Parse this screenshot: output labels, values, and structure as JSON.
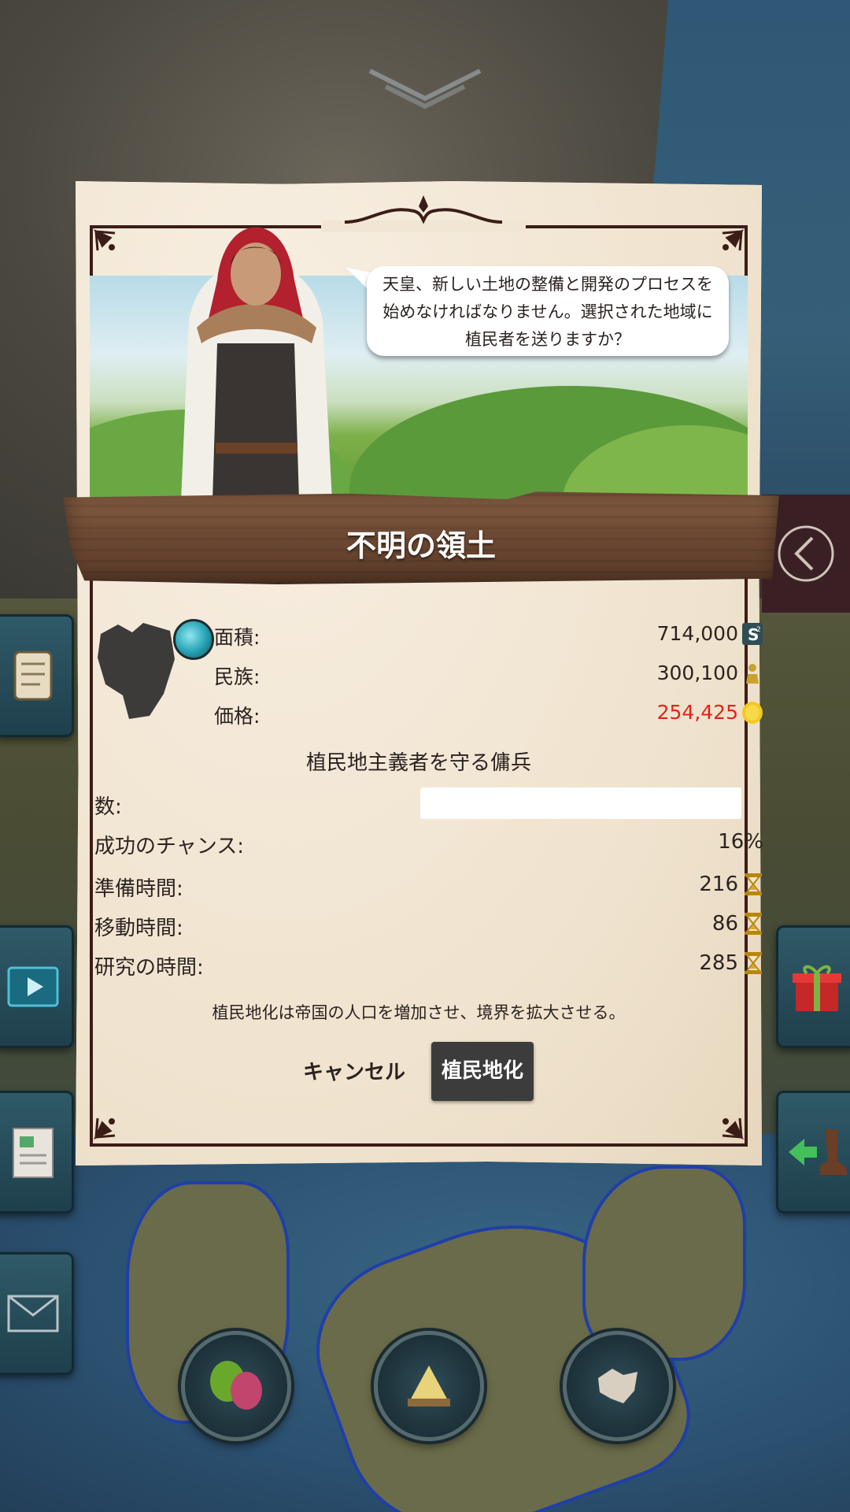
{
  "dialog": {
    "advisor_message": "天皇、新しい土地の整備と開発のプロセスを始めなければなりません。選択された地域に植民者を送りますか？",
    "title": "不明の領土",
    "stats": [
      {
        "label": "面積:",
        "value": "714,000",
        "icon": "area-s2-icon"
      },
      {
        "label": "民族:",
        "value": "300,100",
        "icon": "population-icon"
      },
      {
        "label": "価格:",
        "value": "254,425",
        "icon": "gold-coin-icon",
        "value_color": "#e02418"
      }
    ],
    "section_title": "植民地主義者を守る傭兵",
    "count_label": "数:",
    "count_value": "",
    "rows": [
      {
        "label": "成功のチャンス:",
        "value": "16%"
      },
      {
        "label": "準備時間:",
        "value": "216",
        "icon": "hourglass-icon"
      },
      {
        "label": "移動時間:",
        "value": "86",
        "icon": "hourglass-icon"
      },
      {
        "label": "研究の時間:",
        "value": "285",
        "icon": "hourglass-icon"
      }
    ],
    "note": "植民地化は帝国の人口を増加させ、境界を拡大させる。",
    "cancel_label": "キャンセル",
    "colonize_label": "植民地化"
  },
  "colors": {
    "paper": "#f3e8d8",
    "frame": "#3b1d17",
    "price_red": "#e02418",
    "button_dark": "#3c3c3c"
  }
}
